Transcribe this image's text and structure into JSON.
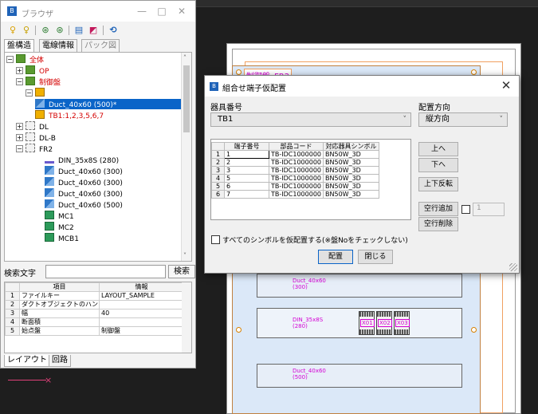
{
  "browser": {
    "title": "ブラウザ",
    "window_buttons": {
      "minimize": "—",
      "maximize": "□",
      "close": "✕"
    },
    "top_tabs": [
      "盤構造",
      "電線情報",
      "パック図"
    ],
    "tree": {
      "root": "全体",
      "op": "OP",
      "control_panel": "制御盤",
      "duct_selected": "Duct_40x60 (500)*",
      "tb_terminals": "TB1:1,2,3,5,6,7",
      "dl": "DL",
      "dlb": "DL-B",
      "fr2": "FR2",
      "din": "DIN_35x8S (280)",
      "ducts": [
        "Duct_40x60 (300)",
        "Duct_40x60 (300)",
        "Duct_40x60 (300)",
        "Duct_40x60 (500)"
      ],
      "mc1": "MC1",
      "mc2": "MC2",
      "mcb1": "MCB1"
    },
    "search": {
      "label": "検索文字",
      "value": "",
      "button": "検索"
    },
    "props": {
      "headers": [
        "項目",
        "情報"
      ],
      "rows": [
        {
          "no": "1",
          "item": "ファイルキー",
          "info": "LAYOUT_SAMPLE"
        },
        {
          "no": "2",
          "item": "ダクトオブジェクトのハンド",
          "info": ""
        },
        {
          "no": "3",
          "item": "幅",
          "info": "40"
        },
        {
          "no": "4",
          "item": "断面積",
          "info": ""
        },
        {
          "no": "5",
          "item": "始点盤",
          "info": "制御盤"
        }
      ]
    },
    "bottom_tabs": [
      "レイアウト",
      "回路"
    ]
  },
  "dialog": {
    "title": "組合せ端子仮配置",
    "device_label": "器具番号",
    "device_value": "TB1",
    "direction_label": "配置方向",
    "direction_value": "縦方向",
    "grid": {
      "headers": [
        "端子番号",
        "部品コード",
        "対応器具シンボル"
      ],
      "rows": [
        {
          "row": "1",
          "terminal": "1",
          "code": "TB-IDC1000000",
          "symbol": "BN50W_3D"
        },
        {
          "row": "2",
          "terminal": "2",
          "code": "TB-IDC1000000",
          "symbol": "BN50W_3D"
        },
        {
          "row": "3",
          "terminal": "3",
          "code": "TB-IDC1000000",
          "symbol": "BN50W_3D"
        },
        {
          "row": "4",
          "terminal": "5",
          "code": "TB-IDC1000000",
          "symbol": "BN50W_3D"
        },
        {
          "row": "5",
          "terminal": "6",
          "code": "TB-IDC1000000",
          "symbol": "BN50W_3D"
        },
        {
          "row": "6",
          "terminal": "7",
          "code": "TB-IDC1000000",
          "symbol": "BN50W_3D"
        }
      ]
    },
    "buttons": {
      "up": "上へ",
      "down": "下へ",
      "reverse": "上下反転",
      "add_blank": "空行追加",
      "delete_blank": "空行削除",
      "place": "配置",
      "close": "閉じる"
    },
    "blank_count": "1",
    "all_symbols_label": "すべてのシンボルを仮配置する(※盤Noをチェックしない)"
  },
  "cad": {
    "panel_title": "制御盤_FR2",
    "duct_top": {
      "name": "Duct_40x60",
      "size": "(300)"
    },
    "din": {
      "name": "DIN_35x8S",
      "size": "(280)"
    },
    "duct_bottom": {
      "name": "Duct_40x60",
      "size": "(500)"
    },
    "terminals": [
      "X01",
      "X02",
      "X03"
    ]
  },
  "colors": {
    "selection": "#0a64c8",
    "cad_label": "#d400d4",
    "panel_fill": "#dbe8f8"
  }
}
